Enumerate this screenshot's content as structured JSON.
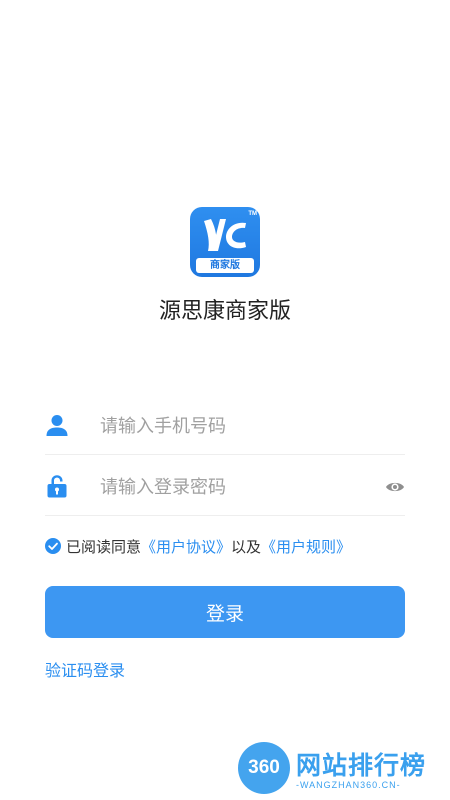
{
  "app": {
    "name": "源思康商家版",
    "logo_tm": "TM",
    "logo_sub": "商家版"
  },
  "login_form": {
    "phone_placeholder": "请输入手机号码",
    "password_placeholder": "请输入登录密码"
  },
  "agreement": {
    "checked": true,
    "prefix": "已阅读同意",
    "user_agreement_link": "《用户协议》",
    "connector": "以及",
    "user_rules_link": "《用户规则》"
  },
  "actions": {
    "login_label": "登录",
    "sms_login_label": "验证码登录"
  },
  "watermark": {
    "badge": "360",
    "title": "网站排行榜",
    "subtitle": "-WANGZHAN360.CN-"
  },
  "colors": {
    "accent": "#3d97f2",
    "link": "#2a8ef0",
    "icon": "#2a8ef0"
  }
}
